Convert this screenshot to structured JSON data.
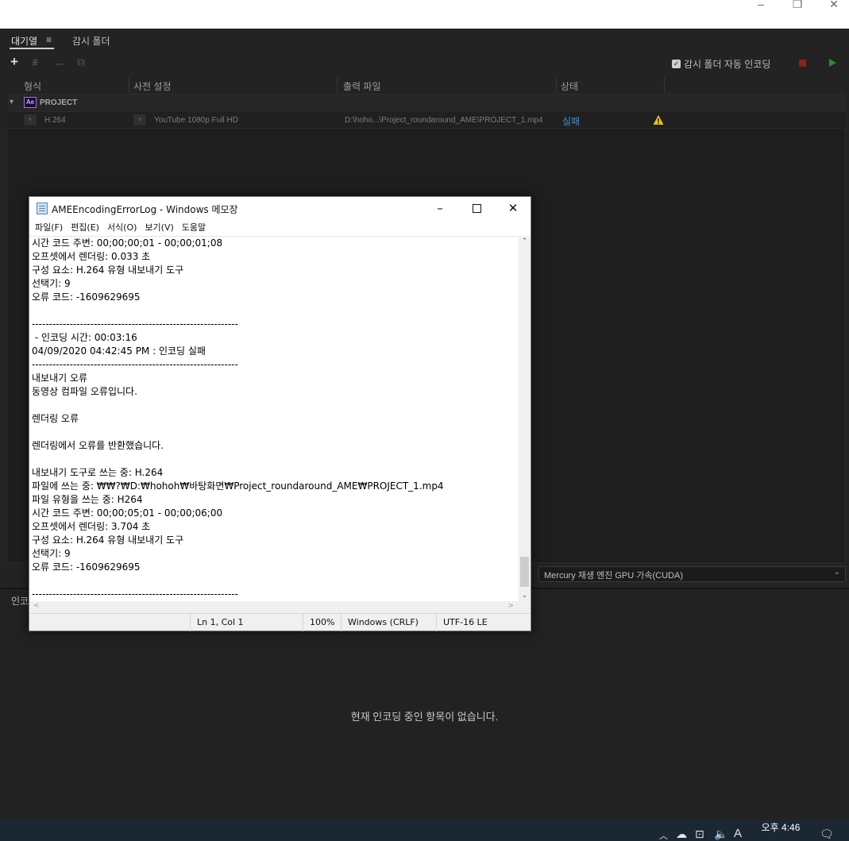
{
  "window": {
    "minimize": "–",
    "maximize": "❐",
    "close": "✕"
  },
  "queue": {
    "tabs": [
      "대기열",
      "감시 폴더"
    ],
    "queue_menu_icon": "≡",
    "toolbar": {
      "add": "+",
      "settings": "≢",
      "remove": "–",
      "duplicate": "⧉"
    },
    "auto_encode_label": "감시 폴더 자동 인코딩",
    "auto_encode_checked": true,
    "columns": [
      "형식",
      "사전 설정",
      "출력 파일",
      "상태"
    ],
    "group": {
      "badge": "Ae",
      "name": "PROJECT"
    },
    "item": {
      "format": "H.264",
      "preset": "YouTube 1080p Full HD",
      "output": "D:\\hoho...\\Project_roundaround_AME\\PROJECT_1.mp4",
      "status": "실패"
    },
    "renderer": "Mercury 재생 엔진 GPU 가속(CUDA)"
  },
  "encoding": {
    "tab": "인코딩",
    "empty_message": "현재 인코딩 중인 항목이 없습니다."
  },
  "notepad": {
    "title": "AMEEncodingErrorLog - Windows 메모장",
    "menu": [
      "파일(F)",
      "편집(E)",
      "서식(O)",
      "보기(V)",
      "도움말"
    ],
    "lines": [
      "시간 코드 주변: 00;00;00;01 - 00;00;01;08",
      "오프셋에서 렌더링: 0.033 초",
      "구성 요소: H.264 유형 내보내기 도구",
      "선택기: 9",
      "오류 코드: -1609629695",
      "",
      "------------------------------------------------------------",
      " - 인코딩 시간: 00:03:16",
      "04/09/2020 04:42:45 PM : 인코딩 실패",
      "------------------------------------------------------------",
      "내보내기 오류",
      "동영상 컴파일 오류입니다.",
      "",
      "렌더링 오류",
      "",
      "렌더링에서 오류를 반환했습니다.",
      "",
      "내보내기 도구로 쓰는 중: H.264",
      "파일에 쓰는 중: ₩₩?₩D:₩hohoh₩바탕화면₩Project_roundaround_AME₩PROJECT_1.mp4",
      "파일 유형을 쓰는 중: H264",
      "시간 코드 주변: 00;00;05;01 - 00;00;06;00",
      "오프셋에서 렌더링: 3.704 초",
      "구성 요소: H.264 유형 내보내기 도구",
      "선택기: 9",
      "오류 코드: -1609629695",
      "",
      "------------------------------------------------------------"
    ],
    "status": {
      "position": "Ln 1, Col 1",
      "zoom": "100%",
      "line_ending": "Windows (CRLF)",
      "encoding": "UTF-16 LE"
    }
  },
  "taskbar": {
    "clock_time": "오후 4:46",
    "ime": "A"
  },
  "colors": {
    "fail_status": "#3a8fd8",
    "warning": "#f0c020",
    "stop": "#8a2020",
    "play": "#2e8a2e",
    "ae_badge": "#9a7ad8"
  }
}
